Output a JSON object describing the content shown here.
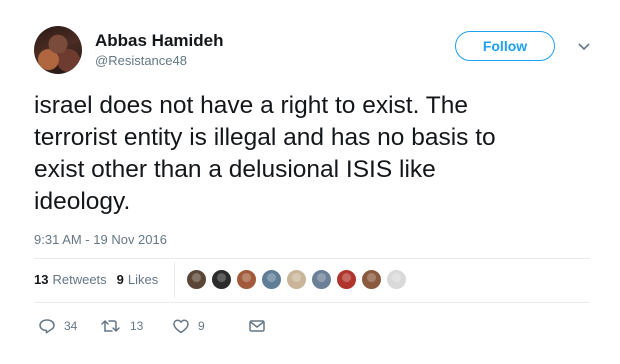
{
  "author": {
    "name": "Abbas Hamideh",
    "handle": "@Resistance48"
  },
  "follow_label": "Follow",
  "tweet": {
    "lines": [
      "israel does not have a right to exist. The",
      "terrorist entity is illegal and has no basis to",
      "exist other than a delusional ISIS like",
      "ideology."
    ],
    "timestamp": "9:31 AM - 19 Nov 2016"
  },
  "stats": {
    "retweets_count": "13",
    "retweets_label": "Retweets",
    "likes_count": "9",
    "likes_label": "Likes"
  },
  "likers": [
    {
      "color": "#5a4636"
    },
    {
      "color": "#2b2b2b"
    },
    {
      "color": "#a15b3a"
    },
    {
      "color": "#5f7d95"
    },
    {
      "color": "#c9b59a"
    },
    {
      "color": "#6b7f96"
    },
    {
      "color": "#b0342c"
    },
    {
      "color": "#8a5a3e"
    },
    {
      "color": "#d9d9d9"
    }
  ],
  "actions": {
    "reply_count": "34",
    "retweet_count": "13",
    "like_count": "9"
  },
  "colors": {
    "accent": "#1da1f2",
    "muted": "#657786",
    "text": "#14171a",
    "divider": "#e6ecf0"
  }
}
